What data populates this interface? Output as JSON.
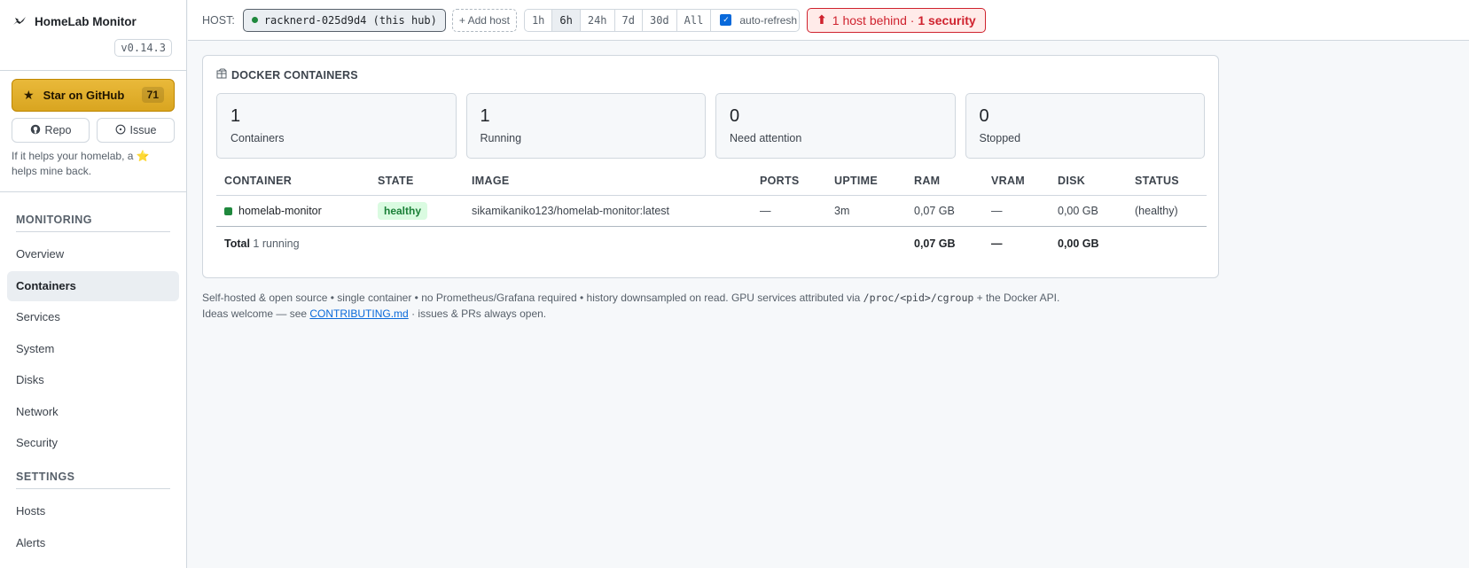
{
  "app": {
    "title": "HomeLab Monitor",
    "version": "v0.14.3",
    "logo_icon": "brand-bird-icon"
  },
  "promo": {
    "star_label": "Star on GitHub",
    "star_count": "71",
    "repo_label": "Repo",
    "issue_label": "Issue",
    "note": "If it helps your homelab, a ⭐ helps mine back."
  },
  "sidebar": {
    "monitoring_heading": "MONITORING",
    "monitoring_items": [
      "Overview",
      "Containers",
      "Services",
      "System",
      "Disks",
      "Network",
      "Security"
    ],
    "active_item": "Containers",
    "settings_heading": "SETTINGS",
    "settings_items": [
      "Hosts",
      "Alerts"
    ]
  },
  "topbar": {
    "host_label": "HOST:",
    "host_value": "racknerd-025d9d4 (this hub)",
    "add_host": "+ Add host",
    "ranges": [
      "1h",
      "6h",
      "24h",
      "7d",
      "30d",
      "All"
    ],
    "active_range": "6h",
    "auto_refresh_label": "auto-refresh",
    "auto_refresh_checked": true,
    "alert_prefix": "1 host behind ·",
    "alert_strong": "1 security"
  },
  "containers_card": {
    "title": "DOCKER CONTAINERS",
    "title_icon": "box-icon",
    "stats": [
      {
        "value": "1",
        "label": "Containers"
      },
      {
        "value": "1",
        "label": "Running"
      },
      {
        "value": "0",
        "label": "Need attention"
      },
      {
        "value": "0",
        "label": "Stopped"
      }
    ],
    "columns": [
      "CONTAINER",
      "STATE",
      "IMAGE",
      "PORTS",
      "UPTIME",
      "RAM",
      "VRAM",
      "DISK",
      "STATUS"
    ],
    "rows": [
      {
        "name": "homelab-monitor",
        "state": "healthy",
        "image": "sikamikaniko123/homelab-monitor:latest",
        "ports": "—",
        "uptime": "3m",
        "ram": "0,07 GB",
        "vram": "—",
        "disk": "0,00 GB",
        "status": "(healthy)"
      }
    ],
    "total": {
      "label": "Total",
      "sub": "1 running",
      "ram": "0,07 GB",
      "vram": "—",
      "disk": "0,00 GB"
    }
  },
  "footer": {
    "line1_pre": "Self-hosted & open source • single container • no Prometheus/Grafana required • history downsampled on read. GPU services attributed via ",
    "line1_code": "/proc/<pid>/cgroup",
    "line1_post": " + the Docker API.",
    "line2_pre": "Ideas welcome — see ",
    "line2_link": "CONTRIBUTING.md",
    "line2_post": " · issues & PRs always open."
  },
  "colors": {
    "accent": "#0969da",
    "healthy": "#1f883d",
    "alert": "#cf222e",
    "star": "#d9a520"
  }
}
